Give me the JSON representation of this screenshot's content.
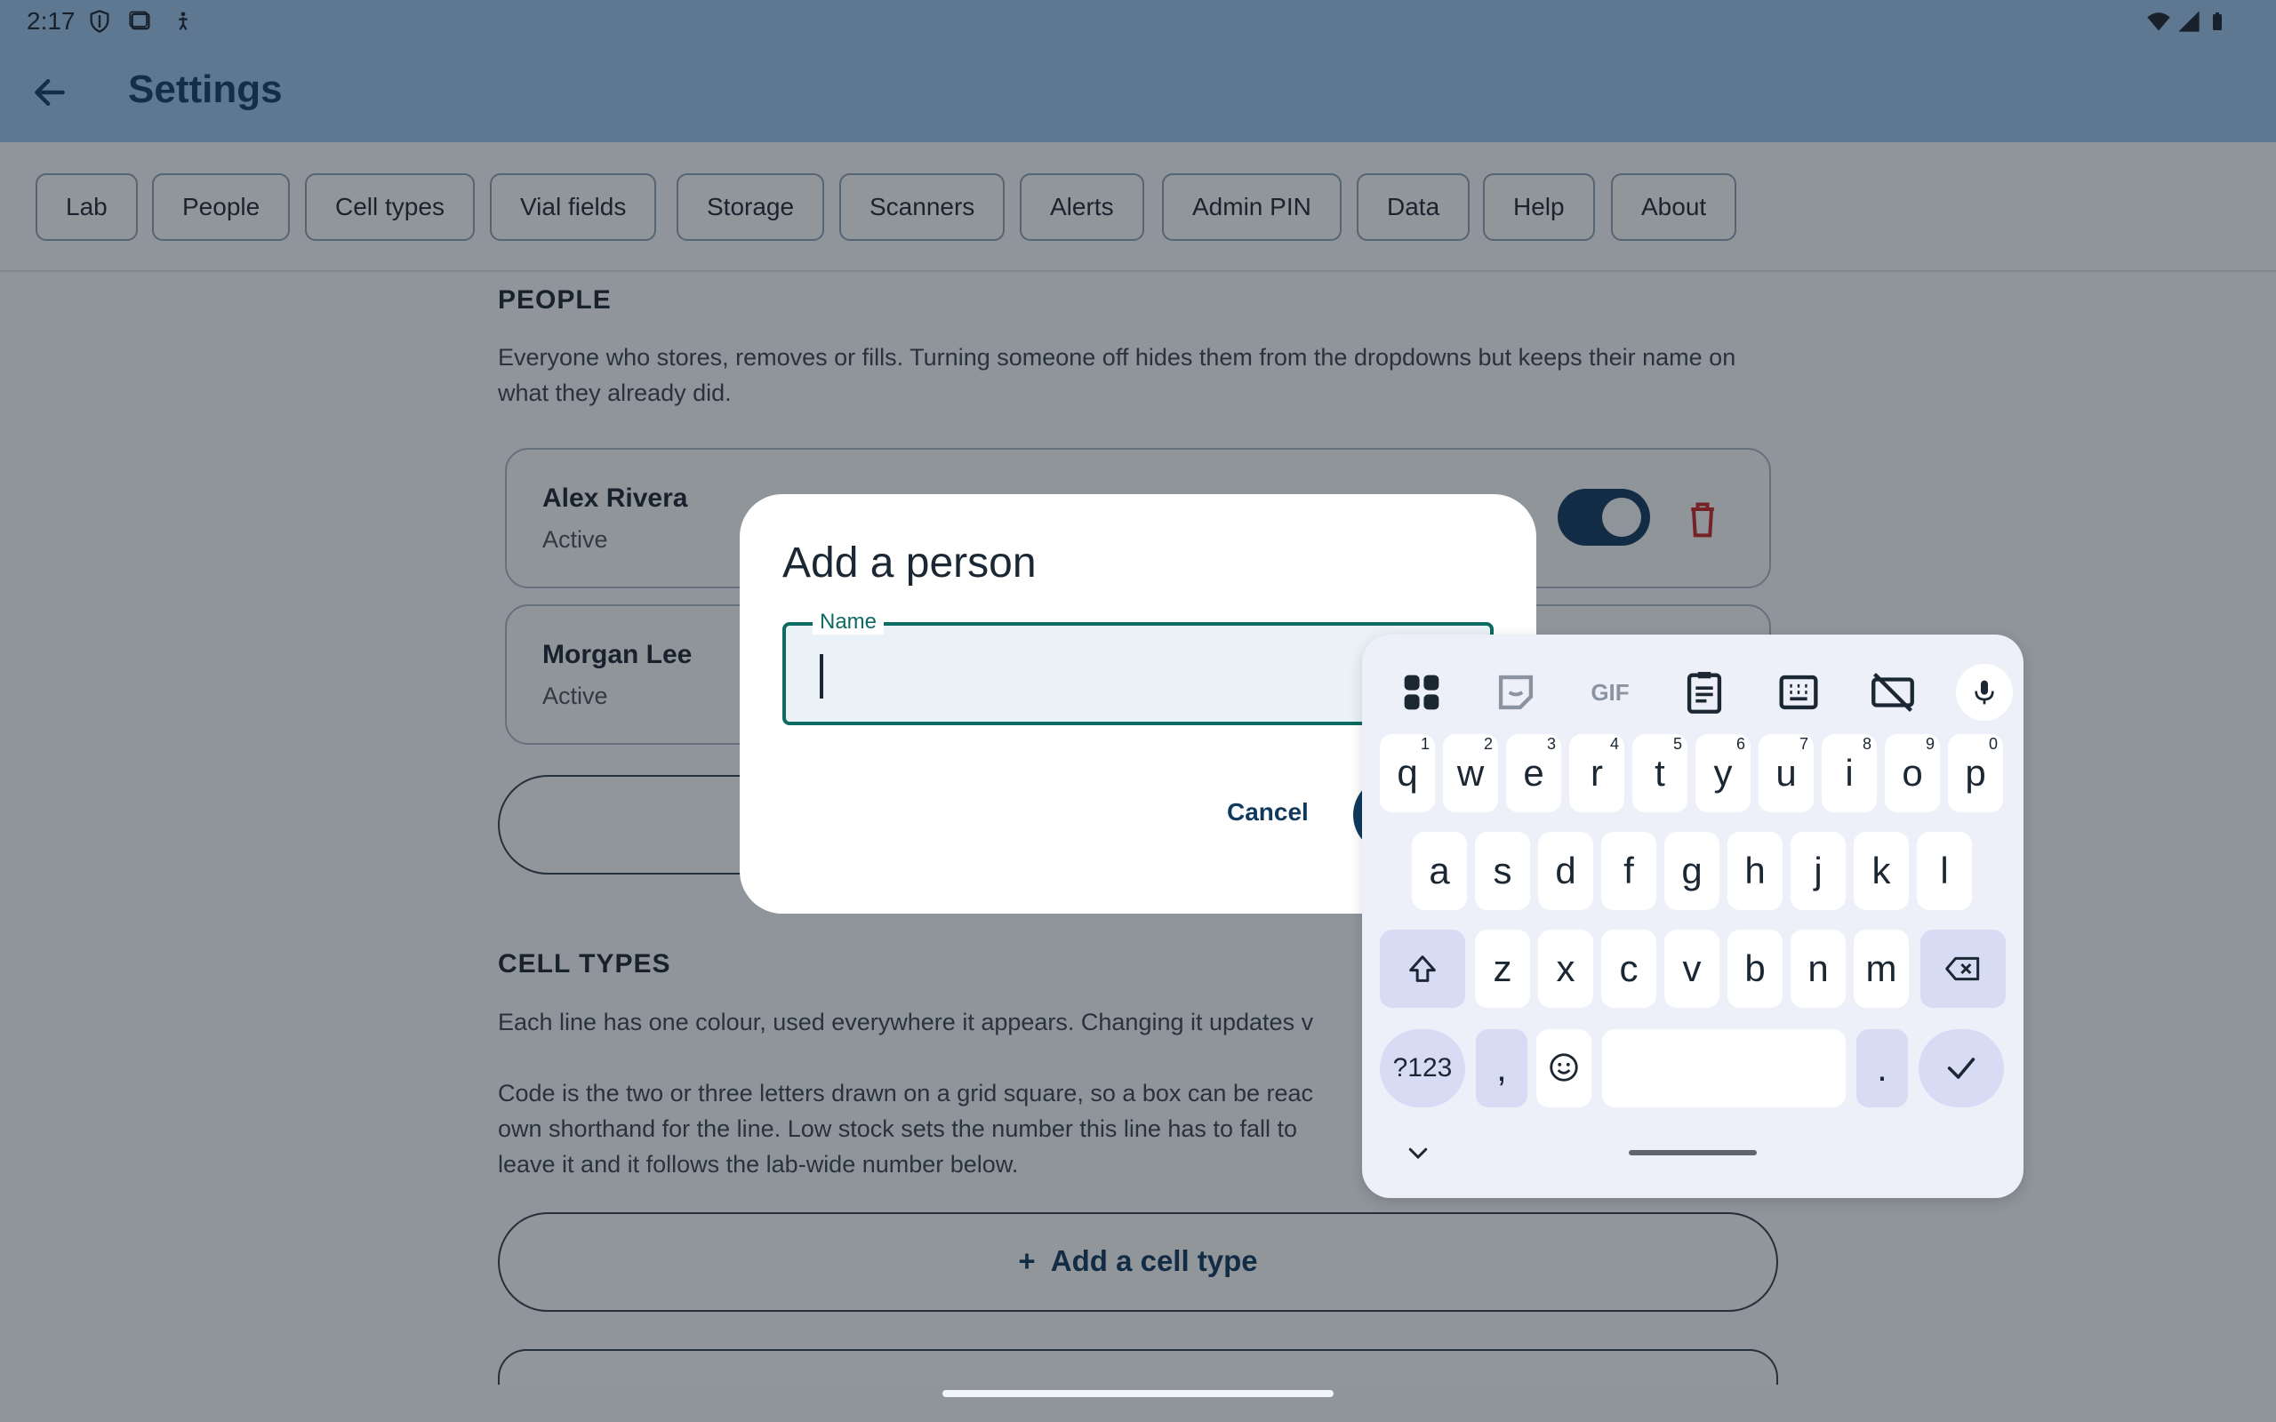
{
  "status_bar": {
    "time": "2:17",
    "left_icons": [
      "shield-icon",
      "screenshot-icon",
      "accessibility-icon"
    ],
    "right_icons": [
      "wifi-icon",
      "signal-icon",
      "battery-icon"
    ]
  },
  "app_bar": {
    "title": "Settings",
    "back_icon": "arrow-back-icon"
  },
  "tabs": [
    {
      "label": "Lab"
    },
    {
      "label": "People"
    },
    {
      "label": "Cell types"
    },
    {
      "label": "Vial fields"
    },
    {
      "label": "Storage"
    },
    {
      "label": "Scanners"
    },
    {
      "label": "Alerts"
    },
    {
      "label": "Admin PIN"
    },
    {
      "label": "Data"
    },
    {
      "label": "Help"
    },
    {
      "label": "About"
    }
  ],
  "people_section": {
    "title": "PEOPLE",
    "description": "Everyone who stores, removes or fills. Turning someone off hides them from the dropdowns but keeps their name on what they already did.",
    "people": [
      {
        "name": "Alex Rivera",
        "status": "Active",
        "enabled": true
      },
      {
        "name": "Morgan Lee",
        "status": "Active",
        "enabled": true
      }
    ]
  },
  "cell_types_section": {
    "title": "CELL TYPES",
    "description_1": "Each line has one colour, used everywhere it appears. Changing it updates v",
    "description_2_line1": "Code is the two or three letters drawn on a grid square, so a box can be reac",
    "description_2_line2": "own shorthand for the line. Low stock sets the number this line has to fall to",
    "description_2_line3": "leave it and it follows the lab-wide number below.",
    "add_button_label": "Add a cell type",
    "add_icon": "plus-icon"
  },
  "dialog": {
    "title": "Add a person",
    "name_label": "Name",
    "name_value": "",
    "cancel_label": "Cancel"
  },
  "keyboard": {
    "toolbar_icons": [
      "apps-grid-icon",
      "sticker-icon",
      "gif-icon",
      "clipboard-icon",
      "numpad-icon",
      "keyboard-off-icon",
      "microphone-icon"
    ],
    "gif_label": "GIF",
    "row1": [
      {
        "key": "q",
        "hint": "1"
      },
      {
        "key": "w",
        "hint": "2"
      },
      {
        "key": "e",
        "hint": "3"
      },
      {
        "key": "r",
        "hint": "4"
      },
      {
        "key": "t",
        "hint": "5"
      },
      {
        "key": "y",
        "hint": "6"
      },
      {
        "key": "u",
        "hint": "7"
      },
      {
        "key": "i",
        "hint": "8"
      },
      {
        "key": "o",
        "hint": "9"
      },
      {
        "key": "p",
        "hint": "0"
      }
    ],
    "row2": [
      "a",
      "s",
      "d",
      "f",
      "g",
      "h",
      "j",
      "k",
      "l"
    ],
    "row3": [
      "z",
      "x",
      "c",
      "v",
      "b",
      "n",
      "m"
    ],
    "symbols_label": "?123",
    "comma_label": ",",
    "period_label": ".",
    "shift_icon": "shift-icon",
    "backspace_icon": "backspace-icon",
    "emoji_icon": "emoji-icon",
    "enter_icon": "check-icon",
    "collapse_icon": "chevron-down-icon"
  }
}
